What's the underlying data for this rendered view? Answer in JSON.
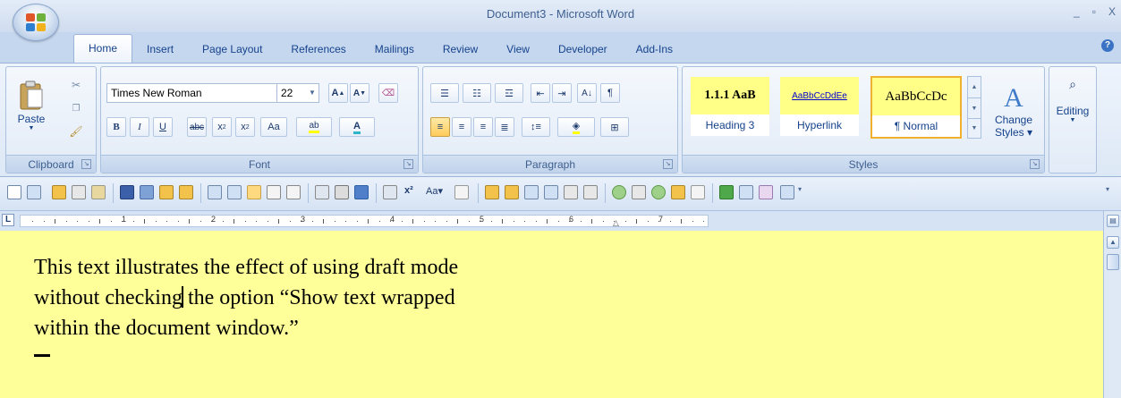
{
  "window": {
    "title": "Document3 - Microsoft Word",
    "minimize": "_",
    "restore": "▫",
    "close": "X",
    "help": "?"
  },
  "tabs": [
    "Home",
    "Insert",
    "Page Layout",
    "References",
    "Mailings",
    "Review",
    "View",
    "Developer",
    "Add-Ins"
  ],
  "active_tab": "Home",
  "clipboard": {
    "paste_label": "Paste",
    "group_label": "Clipboard"
  },
  "font": {
    "family": "Times New Roman",
    "size": "22",
    "grow": "A",
    "shrink": "A",
    "bold": "B",
    "italic": "I",
    "underline": "U",
    "strike": "abc",
    "subscript": "x",
    "superscript": "x",
    "change_case": "Aa",
    "highlight": "ab",
    "font_color": "A",
    "group_label": "Font"
  },
  "paragraph": {
    "group_label": "Paragraph",
    "show_marks": "¶",
    "sort": "A↓"
  },
  "styles": {
    "items": [
      {
        "preview": "1.1.1  AaB",
        "caption": "Heading 3"
      },
      {
        "preview": "AaBbCcDdEe",
        "caption": "Hyperlink"
      },
      {
        "preview": "AaBbCcDc",
        "caption": "¶ Normal"
      }
    ],
    "change_label": "Change",
    "change_label2": "Styles",
    "group_label": "Styles"
  },
  "editing": {
    "label": "Editing"
  },
  "ruler": {
    "numbers": [
      "1",
      "2",
      "3",
      "4",
      "5",
      "6",
      "7"
    ]
  },
  "document": {
    "line1": "This text illustrates the effect of using draft mode",
    "line2_before": "without checking",
    "line2_after": " the option “Show text wrapped",
    "line3": "within the document window.”"
  },
  "colors": {
    "doc_background": "#ffff99",
    "ribbon": "#dde8f6",
    "accent": "#15428b",
    "selected_style_border": "#f0b030"
  }
}
